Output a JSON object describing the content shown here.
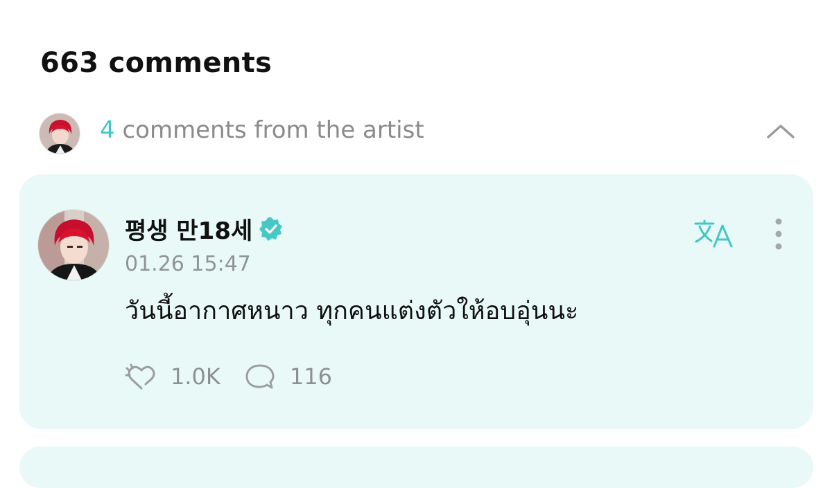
{
  "header": {
    "comment_count_label": "663 comments"
  },
  "artist_comments": {
    "count": "4",
    "label": " comments from the artist",
    "expanded": true,
    "icons": {
      "avatar": "artist-avatar",
      "toggle": "chevron-up-icon"
    }
  },
  "comment": {
    "author": "평생 만18세",
    "verified": true,
    "timestamp": "01.26 15:47",
    "text": "วันนี้อากาศหนาว ทุกคนแต่งตัวให้อบอุ่นนะ",
    "likes": "1.0K",
    "replies": "116",
    "icons": {
      "translate": "translate-icon",
      "more": "more-vertical-icon",
      "like": "heart-icon",
      "reply": "speech-bubble-icon",
      "verified": "verified-badge-icon"
    }
  },
  "colors": {
    "accent": "#3ec7c4",
    "card_background": "#e9f9f7",
    "muted_text": "#8a8a8a"
  }
}
